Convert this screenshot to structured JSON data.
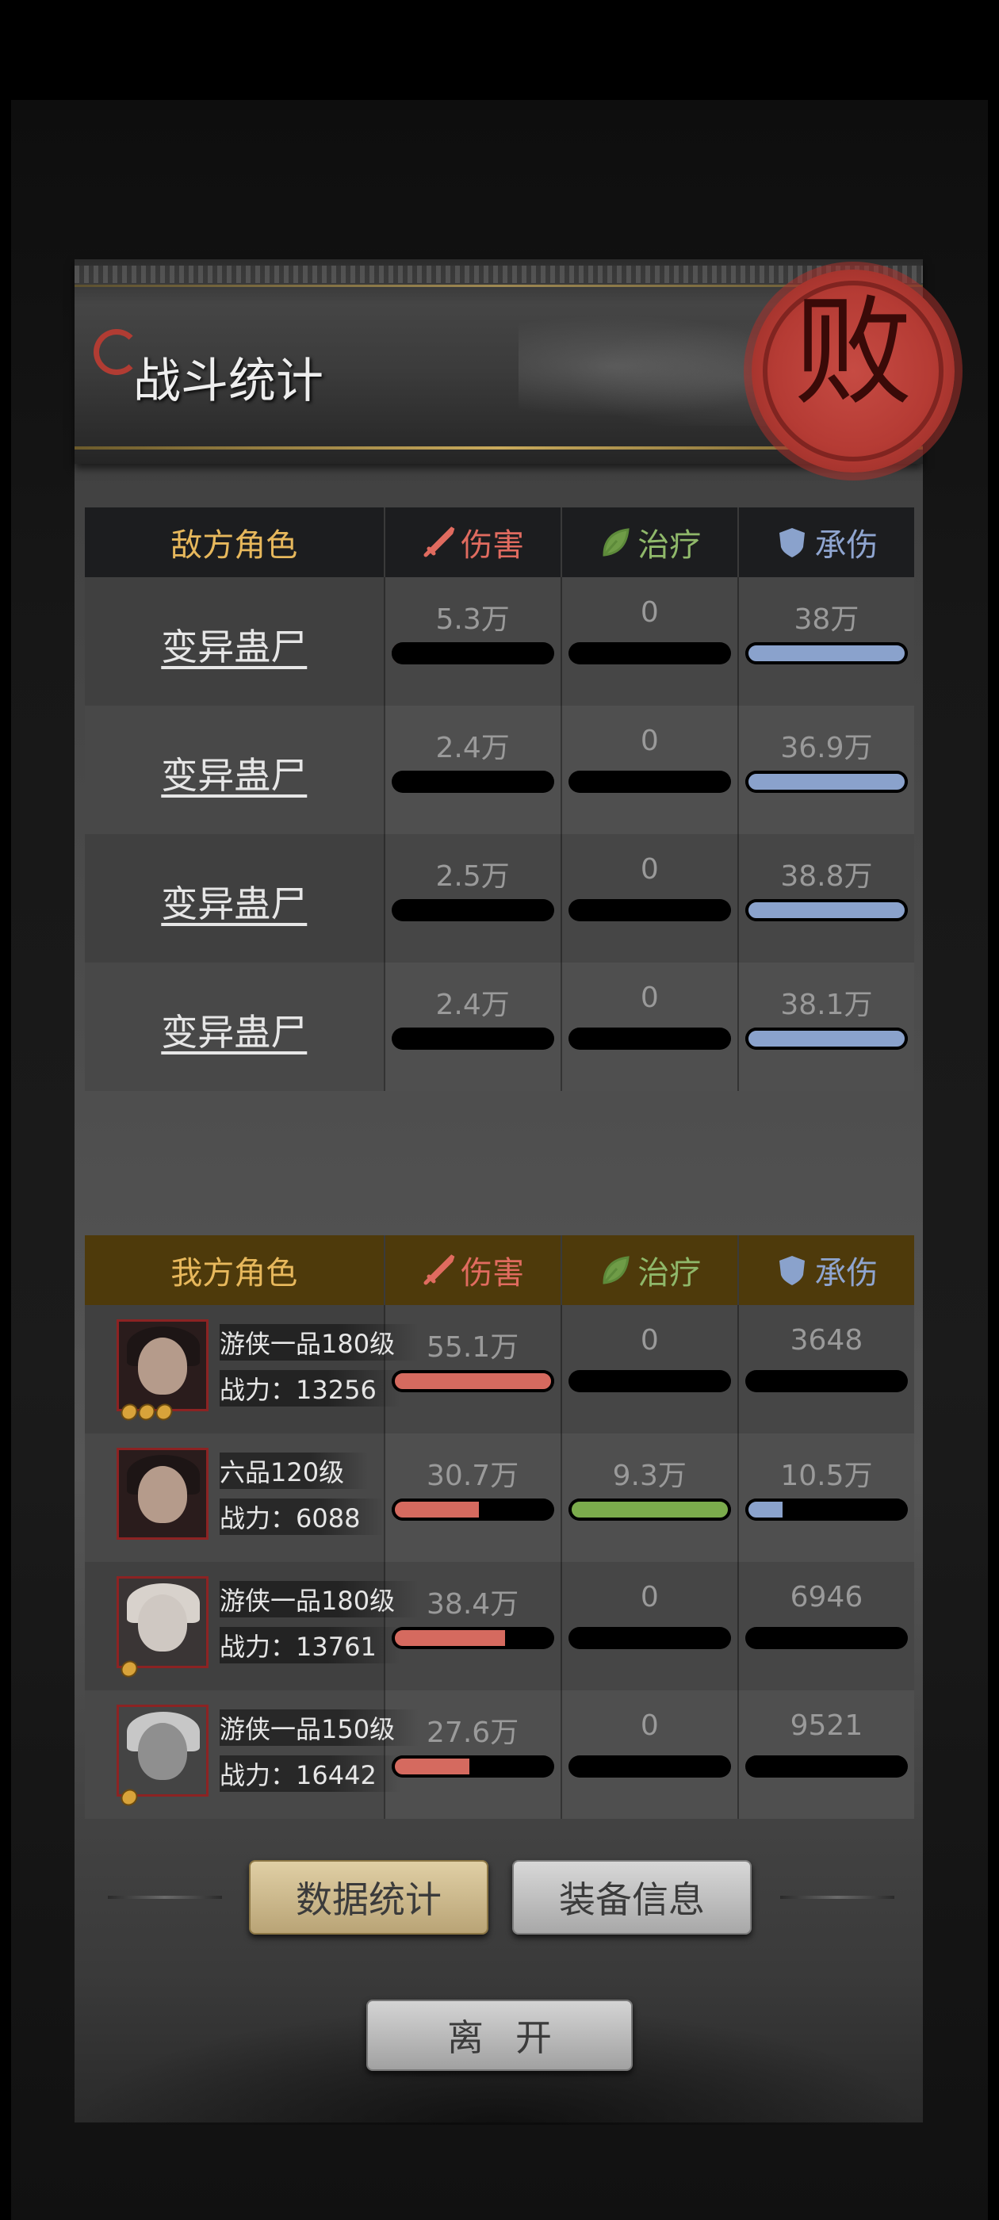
{
  "title": "战斗统计",
  "seal_char": "败",
  "columns": {
    "damage": "伤害",
    "heal": "治疗",
    "taken": "承伤"
  },
  "enemy": {
    "header": "敌方角色",
    "rows": [
      {
        "name": "变异蛊尸",
        "damage": "5.3万",
        "heal": "0",
        "taken": "38万",
        "damage_pct": 3,
        "heal_pct": 0,
        "taken_pct": 100
      },
      {
        "name": "变异蛊尸",
        "damage": "2.4万",
        "heal": "0",
        "taken": "36.9万",
        "damage_pct": 0,
        "heal_pct": 0,
        "taken_pct": 100
      },
      {
        "name": "变异蛊尸",
        "damage": "2.5万",
        "heal": "0",
        "taken": "38.8万",
        "damage_pct": 0,
        "heal_pct": 0,
        "taken_pct": 100
      },
      {
        "name": "变异蛊尸",
        "damage": "2.4万",
        "heal": "0",
        "taken": "38.1万",
        "damage_pct": 0,
        "heal_pct": 0,
        "taken_pct": 100
      }
    ]
  },
  "ally": {
    "header": "我方角色",
    "rows": [
      {
        "rank": "游侠一品180级",
        "power": "战力：13256",
        "stars": 3,
        "damage": "55.1万",
        "heal": "0",
        "taken": "3648",
        "damage_pct": 100,
        "heal_pct": 0,
        "taken_pct": 0
      },
      {
        "rank": "六品120级",
        "power": "战力：6088",
        "stars": 0,
        "damage": "30.7万",
        "heal": "9.3万",
        "taken": "10.5万",
        "damage_pct": 56,
        "heal_pct": 100,
        "taken_pct": 25
      },
      {
        "rank": "游侠一品180级",
        "power": "战力：13761",
        "stars": 1,
        "damage": "38.4万",
        "heal": "0",
        "taken": "6946",
        "damage_pct": 72,
        "heal_pct": 0,
        "taken_pct": 0
      },
      {
        "rank": "游侠一品150级",
        "power": "战力：16442",
        "stars": 1,
        "damage": "27.6万",
        "heal": "0",
        "taken": "9521",
        "damage_pct": 50,
        "heal_pct": 0,
        "taken_pct": 0
      }
    ]
  },
  "buttons": {
    "data": "数据统计",
    "equip": "装备信息",
    "leave": "离开"
  }
}
